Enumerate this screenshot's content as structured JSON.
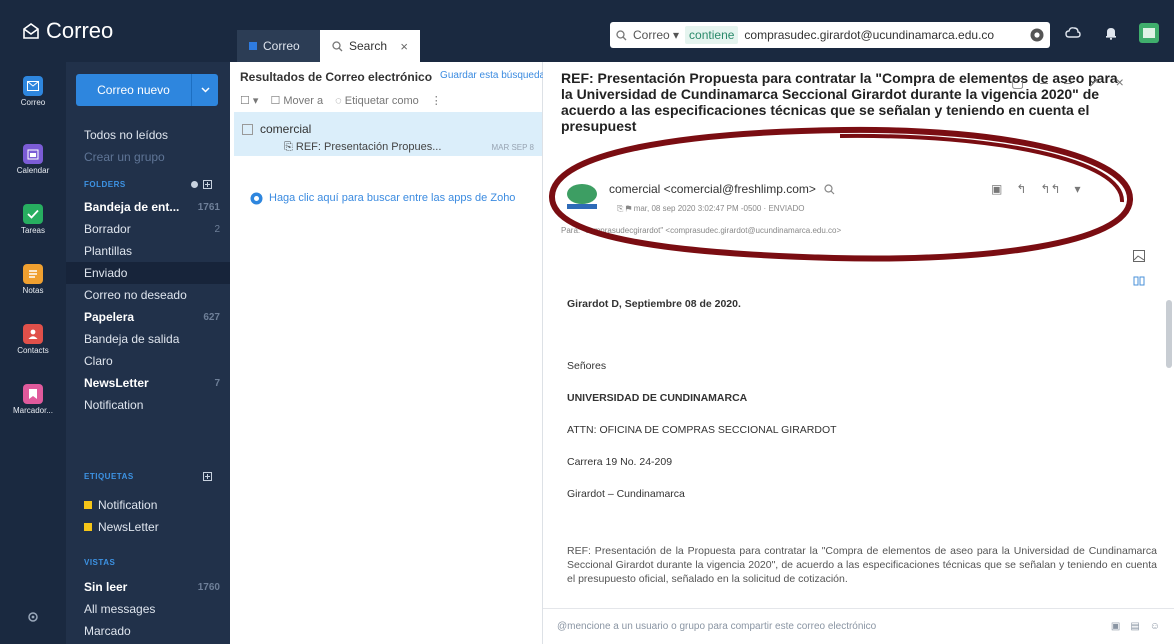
{
  "app": {
    "title": "Correo"
  },
  "tabs": [
    {
      "label": "Correo"
    },
    {
      "label": "Search"
    }
  ],
  "search": {
    "scope": "Correo",
    "operator": "contiene",
    "query": "comprasudec.girardot@ucundinamarca.edu.co"
  },
  "rail": [
    {
      "label": "Correo",
      "icon": "mail-icon",
      "color": "#2e86de"
    },
    {
      "label": "Calendar",
      "icon": "calendar-icon",
      "color": "#7b5cd6"
    },
    {
      "label": "Tareas",
      "icon": "tasks-icon",
      "color": "#27ae60"
    },
    {
      "label": "Notas",
      "icon": "notes-icon",
      "color": "#f0a030"
    },
    {
      "label": "Contacts",
      "icon": "contacts-icon",
      "color": "#e0504a"
    },
    {
      "label": "Marcador...",
      "icon": "bookmark-icon",
      "color": "#e05a9c"
    }
  ],
  "folders": {
    "new_mail": "Correo nuevo",
    "all_unread": "Todos no leídos",
    "create_group": "Crear un grupo",
    "section": "FOLDERS",
    "items": [
      {
        "label": "Bandeja de ent...",
        "count": "1761"
      },
      {
        "label": "Borrador",
        "count": "2"
      },
      {
        "label": "Plantillas",
        "count": ""
      },
      {
        "label": "Enviado",
        "count": ""
      },
      {
        "label": "Correo no deseado",
        "count": ""
      },
      {
        "label": "Papelera",
        "count": "627"
      },
      {
        "label": "Bandeja de salida",
        "count": ""
      },
      {
        "label": "Claro",
        "count": ""
      },
      {
        "label": "NewsLetter",
        "count": "7"
      },
      {
        "label": "Notification",
        "count": ""
      }
    ],
    "tags_section": "ETIQUETAS",
    "tags": [
      {
        "label": "Notification",
        "color": "#f5c518"
      },
      {
        "label": "NewsLetter",
        "color": "#f5c518"
      }
    ],
    "views_section": "VISTAS",
    "views": [
      {
        "label": "Sin leer",
        "count": "1760"
      },
      {
        "label": "All messages",
        "count": ""
      },
      {
        "label": "Marcado",
        "count": ""
      }
    ]
  },
  "results": {
    "title": "Resultados de Correo electrónico",
    "save": "Guardar esta búsqueda",
    "move": "Mover a",
    "tag": "Etiquetar como",
    "item": {
      "from": "comercial",
      "subject": "REF: Presentación Propues...",
      "date": "MAR SEP 8"
    },
    "zoho_hint": "Haga clic aquí para buscar entre las apps de Zoho"
  },
  "mail": {
    "subject": "REF: Presentación  Propuesta para contratar la \"Compra de elementos de aseo para la Universidad de Cundinamarca Seccional Girardot durante la vigencia 2020\" de acuerdo a las especificaciones técnicas que se señalan y teniendo en cuenta el presupuest",
    "sender": "comercial <comercial@freshlimp.com>",
    "meta": "mar, 08 sep 2020 3:02:47 PM -0500  ·  ENVIADO",
    "recipients": "Para: \"comprasudecgirardot\" <comprasudec.girardot@ucundinamarca.edu.co>",
    "lines": [
      {
        "text": "Girardot D, Septiembre 08 de 2020.",
        "bold": true
      },
      {
        "text": "Señores",
        "bold": false
      },
      {
        "text": "UNIVERSIDAD DE CUNDINAMARCA",
        "bold": true
      },
      {
        "text": "ATTN: OFICINA DE COMPRAS SECCIONAL GIRARDOT",
        "bold": false
      },
      {
        "text": "Carrera 19 No. 24-209",
        "bold": false
      },
      {
        "text": "Girardot – Cundinamarca",
        "bold": false
      }
    ],
    "paragraph": "REF: Presentación de la Propuesta para contratar la \"Compra de elementos de aseo para la Universidad de Cundinamarca Seccional Girardot durante la vigencia 2020\", de acuerdo a las especificaciones técnicas que se señalan y teniendo en cuenta el presupuesto oficial, señalado en la solicitud de cotización.",
    "comment_placeholder": "@mencione a un usuario o grupo para compartir este correo electrónico"
  },
  "colors": {
    "header": "#1a2940",
    "accent": "#2e86de",
    "annotation": "#7a0d12"
  }
}
